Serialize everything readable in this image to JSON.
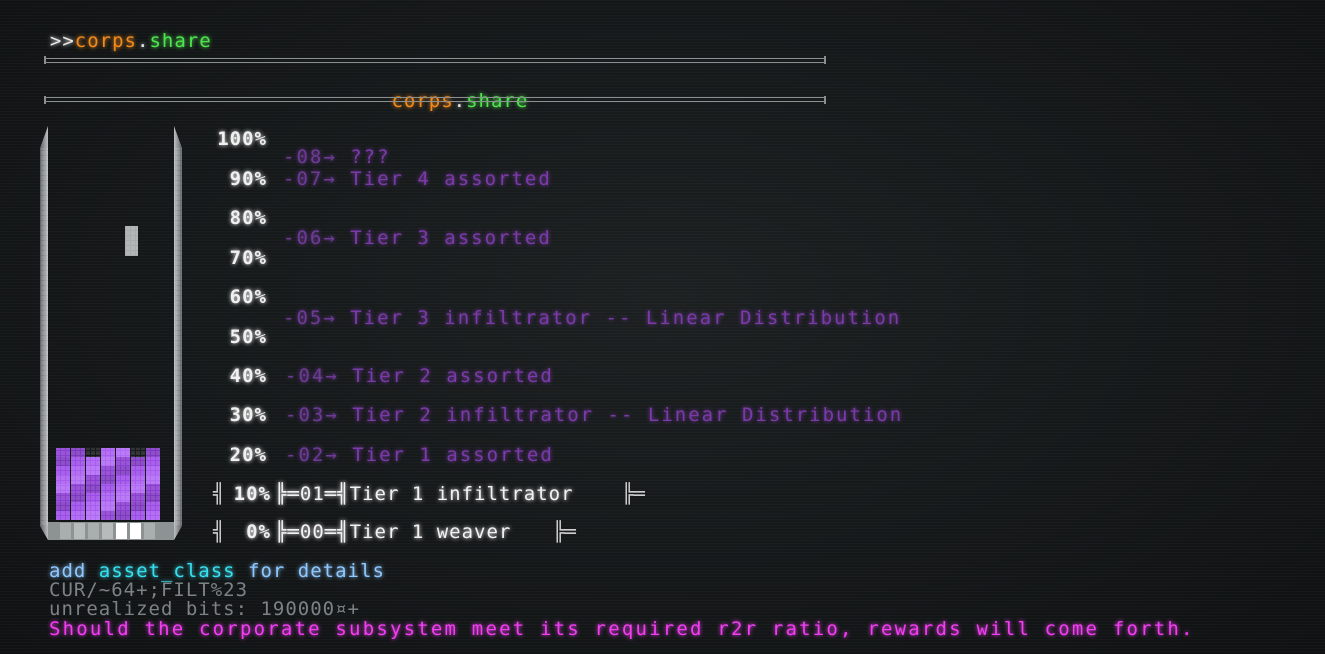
{
  "prompt": {
    "chevrons": ">>",
    "name": "corps",
    "dot": ".",
    "command": "share"
  },
  "header": {
    "name": "corps",
    "dot": ".",
    "command": "share"
  },
  "colors": {
    "background": "#141718",
    "orange": "#f08a1c",
    "green": "#4fe44f",
    "purple": "#7a3aa8",
    "fill_purple": "#9a4be0",
    "magenta": "#f23df2",
    "cyan": "#38e0f0"
  },
  "gauge": {
    "percent_labels": [
      "100%",
      "90%",
      "80%",
      "70%",
      "60%",
      "50%",
      "40%",
      "30%",
      "20%",
      "10%",
      "0%"
    ],
    "fill_level": 0.1
  },
  "tiers": [
    {
      "code": "-08→",
      "label": "???"
    },
    {
      "code": "-07→",
      "label": "Tier 4 assorted"
    },
    {
      "code": "-06→",
      "label": "Tier 3 assorted"
    },
    {
      "code": "-05→",
      "label": "Tier 3 infiltrator -- Linear Distribution"
    },
    {
      "code": "-04→",
      "label": "Tier 2 assorted"
    },
    {
      "code": "-03→",
      "label": "Tier 2 infiltrator -- Linear Distribution"
    },
    {
      "code": "-02→",
      "label": "Tier 1 assorted"
    },
    {
      "code": "╠═01═╣",
      "label": "Tier 1 infiltrator"
    },
    {
      "code": "╠═00═╣",
      "label": "Tier 1 weaver"
    }
  ],
  "active_rows": {
    "row10": {
      "left_mark": "╣",
      "pct": "10%",
      "right_mark": "╠═"
    },
    "row0": {
      "left_mark": "╣",
      "pct": " 0%",
      "right_mark": "╠═"
    }
  },
  "footer": {
    "hint_prefix": "add ",
    "hint_keyword": "asset_class",
    "hint_suffix": " for details",
    "cursor_status": "CUR/~64+;FILT%23",
    "unrealized": "unrealized bits: 190000¤+",
    "message": "Should the corporate subsystem meet its required r2r ratio, rewards will come forth."
  }
}
